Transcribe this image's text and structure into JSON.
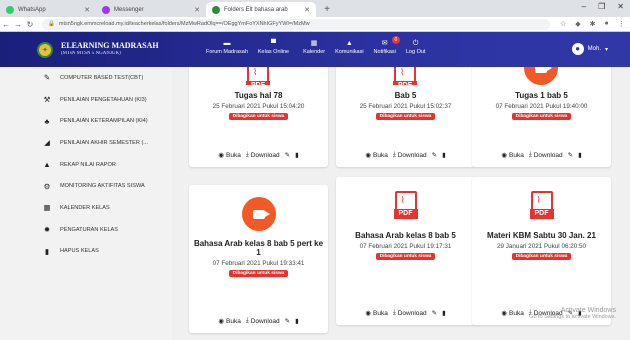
{
  "browser": {
    "tabs": [
      {
        "label": "WhatsApp",
        "color": "#25d366"
      },
      {
        "label": "Messenger",
        "color": "#a334fa"
      },
      {
        "label": "Folders Elt bahasa arab",
        "color": "#2e8b3a"
      }
    ],
    "url": "mtsn5ngk.emmcreload.my.id/teacherkelas/folders/MzMwRadOlq==/OEggYmFoYXNhIGFyYWI=/MzMw",
    "window_controls": [
      "–",
      "❐",
      "✕"
    ]
  },
  "header": {
    "title": "ELEARNING MADRASAH",
    "subtitle": "(MTsN MTSN 5 NGANJUK)",
    "menu": [
      {
        "label": "Forum Madrasah",
        "icon": "forum-icon"
      },
      {
        "label": "Kelas Online",
        "icon": "class-icon"
      },
      {
        "label": "Kalender",
        "icon": "calendar-icon"
      },
      {
        "label": "Komunikasi",
        "icon": "communication-icon"
      },
      {
        "label": "Notifikasi",
        "icon": "notification-icon",
        "badge": "0"
      },
      {
        "label": "Log Out",
        "icon": "logout-icon"
      }
    ],
    "user": "Moh."
  },
  "sidebar": {
    "items": [
      {
        "label": "COMPUTER BASED TEST(CBT)",
        "icon": "edit-icon"
      },
      {
        "label": "PENILAIAN PENGETAHUAN (KI3)",
        "icon": "gavel-icon"
      },
      {
        "label": "PENILAIAN KETERAMPILAN (KI4)",
        "icon": "users-icon"
      },
      {
        "label": "PENILAIAN AKHIR SEMESTER (...",
        "icon": "chart-icon"
      },
      {
        "label": "REKAP NILAI RAPOR",
        "icon": "graduation-icon"
      },
      {
        "label": "MONITORING AKTIFITAS SISWA",
        "icon": "bike-icon"
      },
      {
        "label": "KALENDER KELAS",
        "icon": "calendar-icon"
      },
      {
        "label": "PENGATURAN KELAS",
        "icon": "gear-icon"
      },
      {
        "label": "HAPUS KELAS",
        "icon": "trash-icon"
      }
    ]
  },
  "cards": [
    {
      "title": "Tugas hal 78",
      "date": "25 Februari 2021 Pukul 15:04:20",
      "tag": "Dibagikan untuk siswa",
      "icon": "pdf"
    },
    {
      "title": "Bab 5",
      "date": "25 Februari 2021 Pukul 15:02:37",
      "tag": "Dibagikan untuk siswa",
      "icon": "pdf"
    },
    {
      "title": "Tugas 1 bab 5",
      "date": "07 Februari 2021 Pukul 19:40:00",
      "tag": "Dibagikan untuk siswa",
      "icon": "video"
    },
    {
      "title": "Bahasa Arab kelas 8 bab 5 pert ke 1",
      "date": "07 Februari 2021 Pukul 19:33:41",
      "tag": "Dibagikan untuk siswa",
      "icon": "video"
    },
    {
      "title": "Bahasa Arab kelas 8 bab 5",
      "date": "07 Februari 2021 Pukul 19:17:31",
      "tag": "Dibagikan untuk siswa",
      "icon": "pdf"
    },
    {
      "title": "Materi KBM Sabtu 30 Jan. 21",
      "date": "29 Januari 2021 Pukul 06:20:50",
      "tag": "Dibagikan untuk siswa",
      "icon": "pdf"
    }
  ],
  "actions": {
    "open": "Buka",
    "download": "Download",
    "pdf_label": "PDF"
  },
  "watermark": {
    "line1": "Activate Windows",
    "line2": "Go to Settings to activate Windows."
  }
}
